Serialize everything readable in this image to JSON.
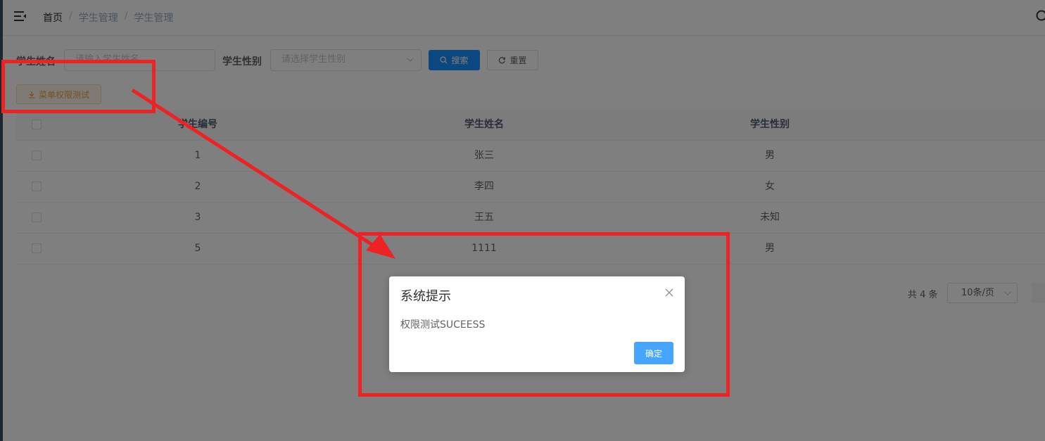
{
  "navbar": {
    "breadcrumb": [
      "首页",
      "学生管理",
      "学生管理"
    ],
    "separator": "/"
  },
  "search_form": {
    "name_label": "学生姓名",
    "name_placeholder": "请输入学生姓名",
    "gender_label": "学生性别",
    "gender_placeholder": "请选择学生性别",
    "search_button": "搜索",
    "reset_button": "重置"
  },
  "toolbar": {
    "menu_permission_button": "菜单权限测试"
  },
  "table": {
    "columns": [
      "学生编号",
      "学生姓名",
      "学生性别"
    ],
    "rows": [
      {
        "id": "1",
        "name": "张三",
        "gender": "男"
      },
      {
        "id": "2",
        "name": "李四",
        "gender": "女"
      },
      {
        "id": "3",
        "name": "王五",
        "gender": "未知"
      },
      {
        "id": "5",
        "name": "1111",
        "gender": "男"
      }
    ]
  },
  "pagination": {
    "total_text": "共 4 条",
    "page_size": "10条/页"
  },
  "dialog": {
    "title": "系统提示",
    "message": "权限测试SUCEESS",
    "confirm_button": "确定"
  },
  "colors": {
    "primary": "#1890ff",
    "warning": "#e6a23c",
    "annotation": "#ee2222",
    "dialog_confirm": "#46a6ff"
  },
  "icons": [
    "hamburger-icon",
    "search-icon",
    "chevron-down-icon",
    "download-icon",
    "refresh-icon",
    "close-icon"
  ]
}
